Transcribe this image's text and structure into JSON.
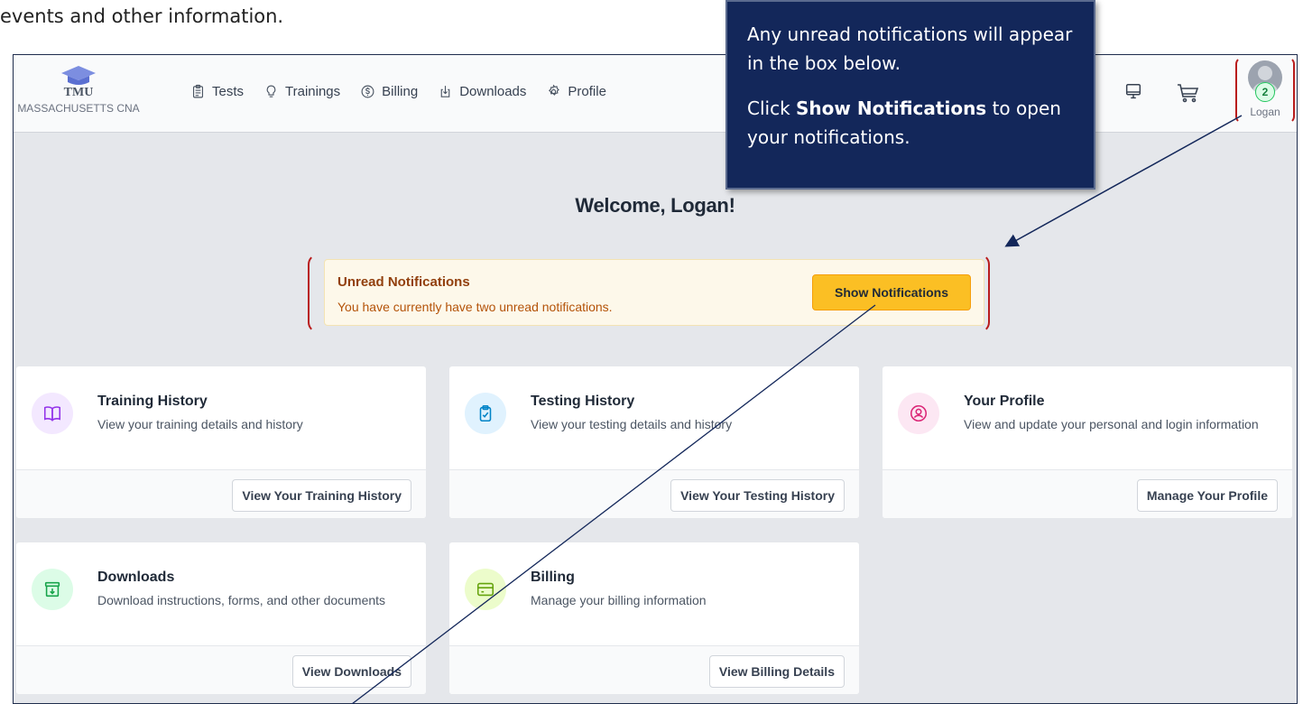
{
  "intro_text": "events and other information.",
  "nav": {
    "logo_brand": "TMU",
    "logo_sub": "MASSACHUSETTS CNA",
    "links": [
      {
        "label": "Tests",
        "icon": "clipboard-icon"
      },
      {
        "label": "Trainings",
        "icon": "lightbulb-icon"
      },
      {
        "label": "Billing",
        "icon": "dollar-icon"
      },
      {
        "label": "Downloads",
        "icon": "download-icon"
      },
      {
        "label": "Profile",
        "icon": "gear-icon"
      }
    ],
    "user_name": "Logan",
    "notification_count": "2"
  },
  "welcome": "Welcome, Logan!",
  "notifications": {
    "title": "Unread Notifications",
    "text": "You have currently have two unread notifications.",
    "button": "Show Notifications"
  },
  "cards": [
    {
      "title": "Training History",
      "desc": "View your training details and history",
      "button": "View Your Training History",
      "icon": "book-icon",
      "icon_bg": "#f3e8ff",
      "icon_color": "#9333ea"
    },
    {
      "title": "Testing History",
      "desc": "View your testing details and history",
      "button": "View Your Testing History",
      "icon": "clipboard-check-icon",
      "icon_bg": "#e0f2fe",
      "icon_color": "#0284c7"
    },
    {
      "title": "Your Profile",
      "desc": "View and update your personal and login information",
      "button": "Manage Your Profile",
      "icon": "user-circle-icon",
      "icon_bg": "#fce7f3",
      "icon_color": "#db2777"
    },
    {
      "title": "Downloads",
      "desc": "Download instructions, forms, and other documents",
      "button": "View Downloads",
      "icon": "archive-download-icon",
      "icon_bg": "#dcfce7",
      "icon_color": "#16a34a"
    },
    {
      "title": "Billing",
      "desc": "Manage your billing information",
      "button": "View Billing Details",
      "icon": "credit-card-icon",
      "icon_bg": "#ecfccb",
      "icon_color": "#65a30d"
    }
  ],
  "callout": {
    "line1": "Any unread notifications will appear in the box below.",
    "line2_pre": "Click ",
    "line2_bold": "Show Notifications",
    "line2_post": " to open your notifications."
  },
  "colors": {
    "callout_bg": "#13275a",
    "highlight_red": "#b91c1c",
    "button_yellow": "#fbbf24"
  }
}
